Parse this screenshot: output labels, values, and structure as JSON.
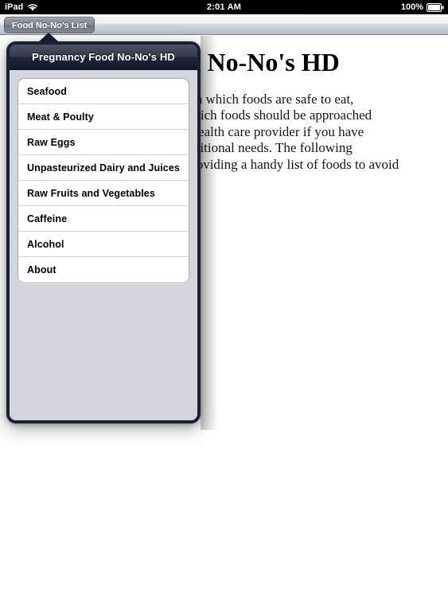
{
  "status_bar": {
    "device_label": "iPad",
    "wifi_icon": "wifi-icon",
    "time": "2:01 AM",
    "battery_percent": "100%",
    "battery_icon": "battery-full-icon"
  },
  "toolbar": {
    "list_button_label": "Food No-No's List"
  },
  "article": {
    "title": "Pregnancy Food No-No's HD",
    "body_lines": [
      "Use this handy reference to learn which foods are safe to eat,",
      "which should be limited, and which foods should be approached",
      "with caution. Check with your health care provider if you have",
      "questions about your diet or nutritional needs. The following",
      "information may help you by providing a handy list of foods to avoid"
    ]
  },
  "popover": {
    "title": "Pregnancy Food No-No's HD",
    "menu_items": [
      {
        "label": "Seafood"
      },
      {
        "label": "Meat & Poulty"
      },
      {
        "label": "Raw Eggs"
      },
      {
        "label": "Unpasteurized Dairy and Juices"
      },
      {
        "label": "Raw Fruits and Vegetables"
      },
      {
        "label": "Caffeine"
      },
      {
        "label": "Alcohol"
      },
      {
        "label": "About"
      }
    ]
  },
  "colors": {
    "status_bar_bg": "#000000",
    "popover_border": "#1a1f33",
    "popover_body_bg": "#d2d6dc",
    "navbar_dark": "#20253a",
    "row_bg": "#ffffff",
    "page_bg": "#ffffff"
  }
}
